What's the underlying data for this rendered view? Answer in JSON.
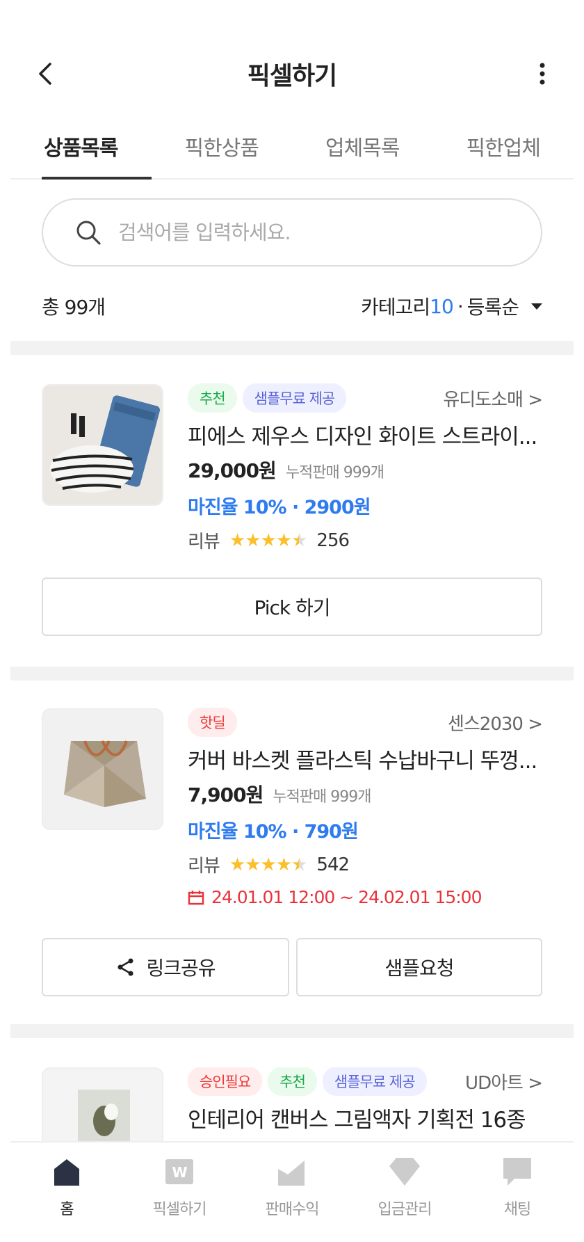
{
  "header": {
    "title": "픽셀하기"
  },
  "tabs": [
    {
      "label": "상품목록"
    },
    {
      "label": "픽한상품"
    },
    {
      "label": "업체목록"
    },
    {
      "label": "픽한업체"
    }
  ],
  "search": {
    "placeholder": "검색어를 입력하세요."
  },
  "summary": {
    "total": "총 99개",
    "category_label": "카테고리",
    "category_count": "10",
    "separator": "·",
    "sort": "등록순"
  },
  "products": [
    {
      "tags": [
        "추천",
        "샘플무료 제공"
      ],
      "seller": "유디도소매 >",
      "name": "피에스 제우스 디자인 화이트 스트라이...",
      "price": "29,000원",
      "sold": "누적판매 999개",
      "margin": "마진율 10% · 2900원",
      "review_label": "리뷰",
      "rating": 4.5,
      "review_count": "256",
      "button": "Pick 하기"
    },
    {
      "tags": [
        "핫딜"
      ],
      "seller": "센스2030 >",
      "name": "커버 바스켓 플라스틱 수납바구니 뚜껑...",
      "price": "7,900원",
      "sold": "누적판매 999개",
      "margin": "마진율 10% · 790원",
      "review_label": "리뷰",
      "rating": 4.5,
      "review_count": "542",
      "period": "24.01.01 12:00 ~ 24.02.01 15:00",
      "buttons": [
        "링크공유",
        "샘플요청"
      ]
    },
    {
      "tags": [
        "승인필요",
        "추천",
        "샘플무료 제공"
      ],
      "seller": "UD아트 >",
      "name": "인테리어 캔버스 그림액자 기획전 16종"
    }
  ],
  "bottom_nav": [
    {
      "label": "홈"
    },
    {
      "label": "픽셀하기"
    },
    {
      "label": "판매수익"
    },
    {
      "label": "입금관리"
    },
    {
      "label": "채팅"
    }
  ],
  "colors": {
    "accent_blue": "#2e7bf0",
    "star": "#fbbf2c",
    "hot_red": "#ee3a3a",
    "recommend_green": "#1aa94a"
  }
}
